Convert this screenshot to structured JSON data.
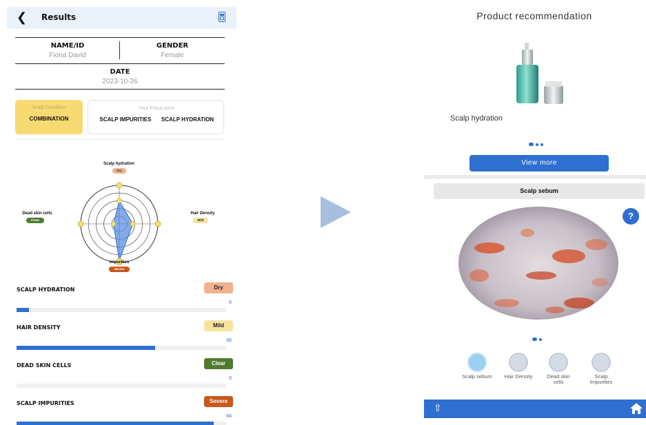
{
  "left_panel": {
    "title": "Results",
    "info": {
      "name_label": "NAME/ID",
      "name_value": "Fiona David",
      "gender_label": "GENDER",
      "gender_value": "Female",
      "date_label": "DATE",
      "date_value": "2023-10-26"
    },
    "condition": {
      "label": "Scalp Condition",
      "value": "COMBINATION"
    },
    "focus": {
      "label": "Your Focus Area",
      "items": [
        "SCALP IMPURITIES",
        "SCALP HYDRATION"
      ]
    },
    "radar": {
      "axes": [
        {
          "name": "Scalp hydration",
          "badge": "Dry",
          "badge_color": "#f0b28e",
          "value": 0.6
        },
        {
          "name": "Hair Density",
          "badge": "Mild",
          "badge_color": "#f7e3a0",
          "value": 0.35
        },
        {
          "name": "Impurities",
          "badge": "Severe",
          "badge_color": "#c8581c",
          "value": 0.95
        },
        {
          "name": "Dead skin cells",
          "badge": "Clean",
          "badge_color": "#4f7b2e",
          "value": 0.15
        }
      ]
    },
    "metrics": [
      {
        "name": "SCALP HYDRATION",
        "badge": "Dry",
        "badge_bg": "#f0b28e",
        "badge_fg": "#222",
        "score": "6",
        "fraction": 0.06
      },
      {
        "name": "HAIR DENSITY",
        "badge": "Mild",
        "badge_bg": "#f7e3a0",
        "badge_fg": "#222",
        "score": "66",
        "fraction": 0.66
      },
      {
        "name": "DEAD SKIN CELLS",
        "badge": "Clear",
        "badge_bg": "#4f7b2e",
        "badge_fg": "#ffffff",
        "score": "0",
        "fraction": 0.0
      },
      {
        "name": "SCALP IMPURITIES",
        "badge": "Severe",
        "badge_bg": "#c8581c",
        "badge_fg": "#ffffff",
        "score": "94",
        "fraction": 0.94
      }
    ]
  },
  "right_panel": {
    "product_title": "Product recommendation",
    "product_name": "Scalp hydration",
    "view_more": "View more",
    "section_title": "Scalp sebum",
    "help": "?",
    "nav": [
      {
        "label": "Scalp sebum",
        "icon": "sebum-icon"
      },
      {
        "label": "Hair Density",
        "icon": "hair-density-icon"
      },
      {
        "label": "Dead skin cells",
        "icon": "dead-skin-icon"
      },
      {
        "label": "Scalp Impurities",
        "icon": "impurities-icon"
      }
    ]
  },
  "colors": {
    "accent": "#2f6fd0",
    "header_bg": "#e9f1fb",
    "condition_card": "#f7db72",
    "arrow": "#a8bedf"
  }
}
